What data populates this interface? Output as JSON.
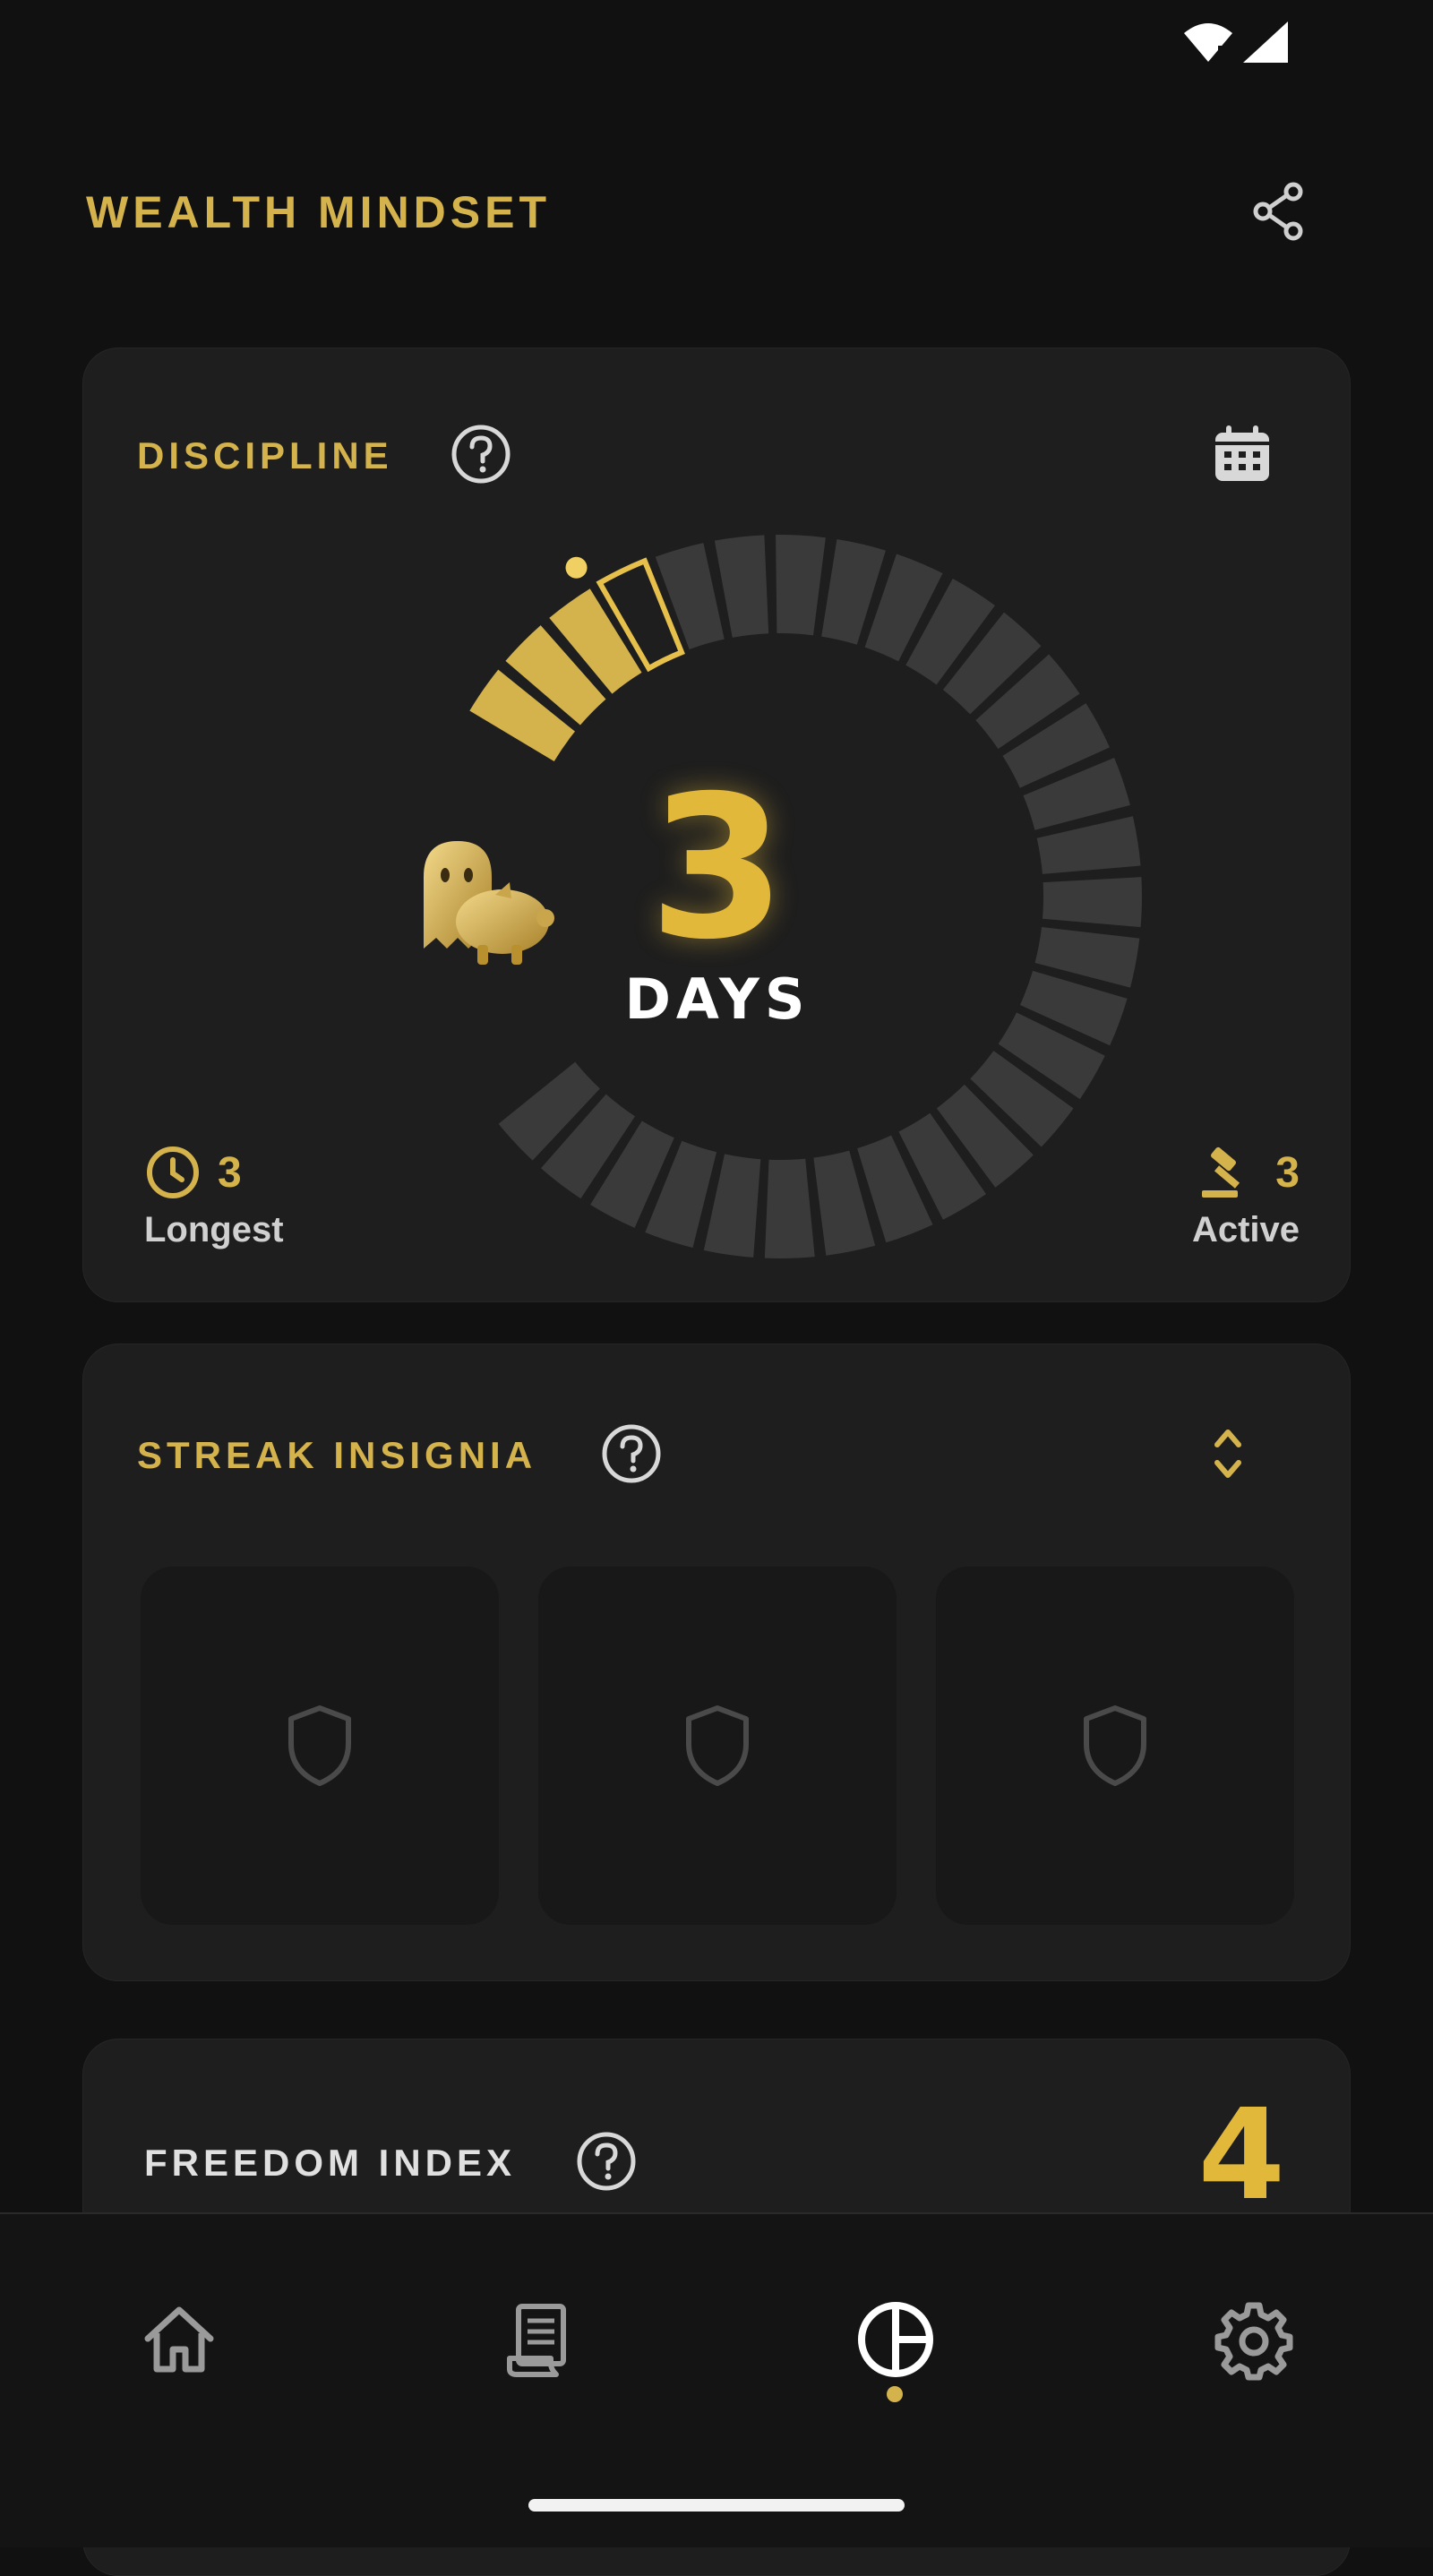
{
  "app": {
    "title": "WEALTH MINDSET",
    "accent_color": "#d4b24c",
    "background_color": "#111111"
  },
  "header": {
    "share_icon": "share-icon"
  },
  "discipline": {
    "title": "DISCIPLINE",
    "help_icon": "help-circle-icon",
    "calendar_icon": "calendar-icon",
    "streak_days": "3",
    "days_label": "DAYS",
    "progress_segments_filled": 3,
    "progress_segments_total": 30,
    "mascot_icon": "ghost-piggy-bank-icon",
    "longest": {
      "value": "3",
      "label": "Longest",
      "icon": "clock-icon"
    },
    "active": {
      "value": "3",
      "label": "Active",
      "icon": "gavel-icon"
    }
  },
  "insignia": {
    "title": "STREAK INSIGNIA",
    "help_icon": "help-circle-icon",
    "expand_icon": "expand-collapse-icon",
    "slots": [
      {
        "icon": "shield-icon",
        "locked": true
      },
      {
        "icon": "shield-icon",
        "locked": true
      },
      {
        "icon": "shield-icon",
        "locked": true
      }
    ]
  },
  "freedom": {
    "title": "FREEDOM INDEX",
    "help_icon": "help-circle-icon",
    "value": "4"
  },
  "nav": {
    "items": [
      {
        "name": "home",
        "icon": "home-icon",
        "active": false
      },
      {
        "name": "journal",
        "icon": "scroll-icon",
        "active": false
      },
      {
        "name": "stats",
        "icon": "pie-chart-icon",
        "active": true
      },
      {
        "name": "settings",
        "icon": "gear-icon",
        "active": false
      }
    ]
  }
}
